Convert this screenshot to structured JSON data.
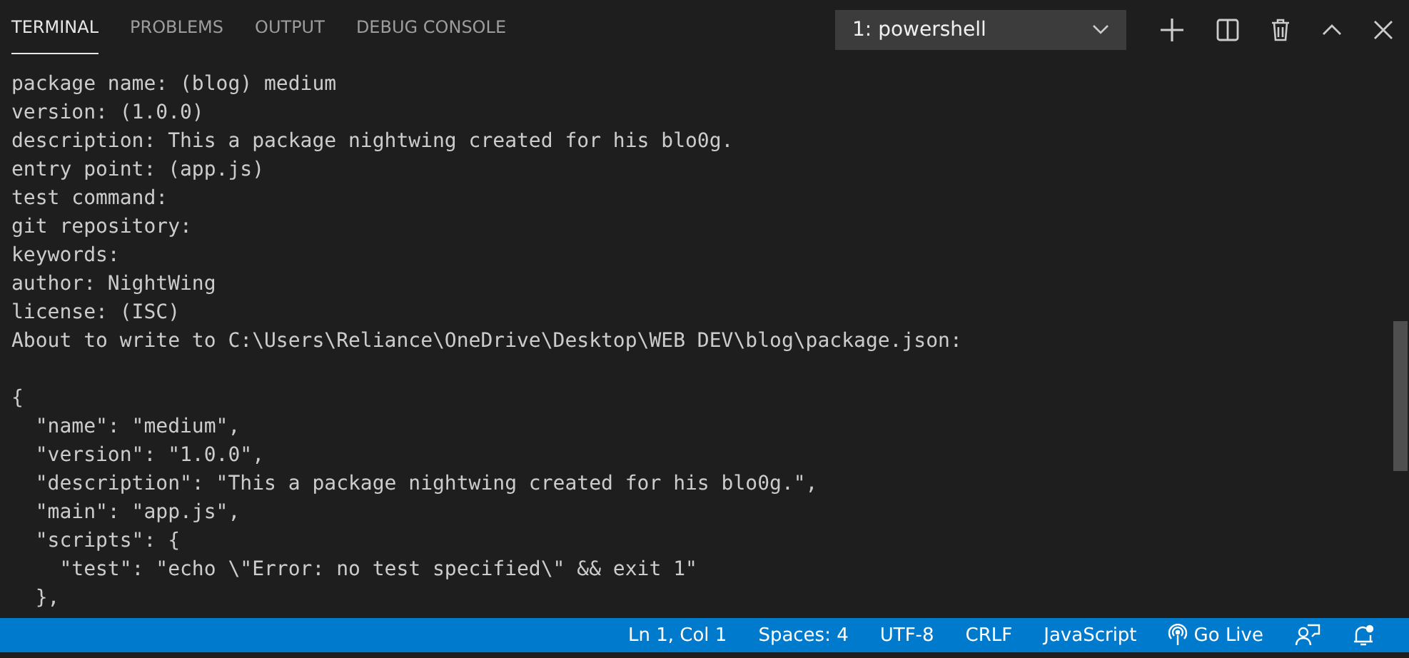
{
  "tabs": [
    {
      "label": "TERMINAL",
      "selected": true
    },
    {
      "label": "PROBLEMS",
      "selected": false
    },
    {
      "label": "OUTPUT",
      "selected": false
    },
    {
      "label": "DEBUG CONSOLE",
      "selected": false
    }
  ],
  "terminal_select": {
    "value": "1: powershell"
  },
  "prompt_lines": [
    "package name: (blog) medium",
    "version: (1.0.0)",
    "description: This a package nightwing created for his blo0g.",
    "entry point: (app.js)",
    "test command:",
    "git repository:",
    "keywords:",
    "author: NightWing",
    "license: (ISC)",
    "About to write to C:\\Users\\Reliance\\OneDrive\\Desktop\\WEB DEV\\blog\\package.json:"
  ],
  "json_lines": [
    "{",
    "  \"name\": \"medium\",",
    "  \"version\": \"1.0.0\",",
    "  \"description\": \"This a package nightwing created for his blo0g.\",",
    "  \"main\": \"app.js\",",
    "  \"scripts\": {",
    "    \"test\": \"echo \\\"Error: no test specified\\\" && exit 1\"",
    "  },"
  ],
  "status_bar": [
    {
      "label": "Ln 1, Col 1"
    },
    {
      "label": "Spaces: 4"
    },
    {
      "label": "UTF-8"
    },
    {
      "label": "CRLF"
    },
    {
      "label": "JavaScript"
    },
    {
      "label": "Go Live",
      "kind": "live"
    }
  ]
}
